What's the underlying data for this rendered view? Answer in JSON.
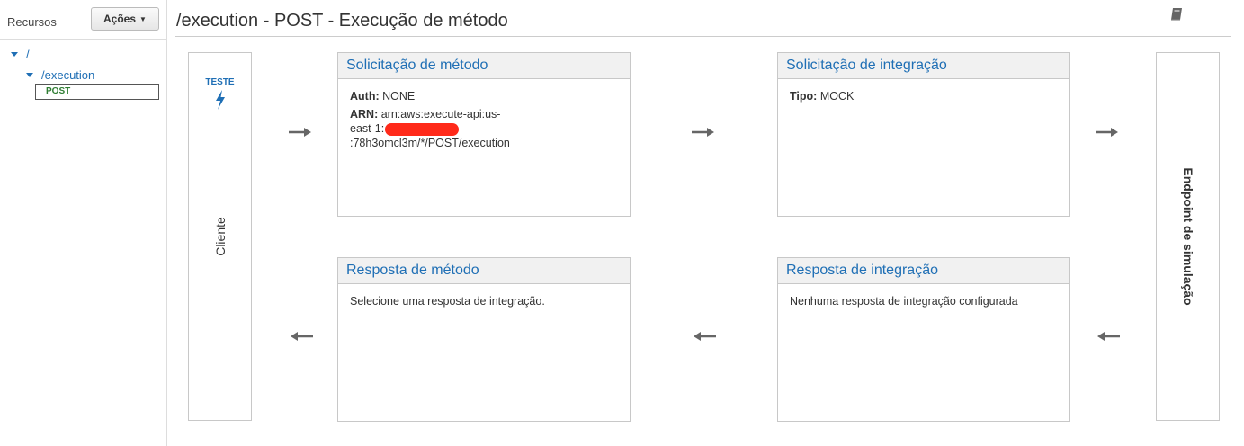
{
  "sidebar": {
    "title": "Recursos",
    "actions_label": "Ações",
    "tree": {
      "root": "/",
      "child": "/execution",
      "method": "POST"
    }
  },
  "header": {
    "title": "/execution - POST - Execução de método"
  },
  "client": {
    "test_label": "TESTE",
    "label": "Cliente"
  },
  "endpoint": {
    "label": "Endpoint de simulação"
  },
  "method_request": {
    "title": "Solicitação de método",
    "auth_key": "Auth:",
    "auth_value": "NONE",
    "arn_key": "ARN:",
    "arn_value_1": "arn:aws:execute-api:us-",
    "arn_value_2a": "east-1:",
    "arn_value_2b": ":78h3omcl3m/*/POST/execution"
  },
  "integration_request": {
    "title": "Solicitação de integração",
    "type_key": "Tipo:",
    "type_value": "MOCK"
  },
  "method_response": {
    "title": "Resposta de método",
    "body": "Selecione uma resposta de integração."
  },
  "integration_response": {
    "title": "Resposta de integração",
    "body": "Nenhuma resposta de integração configurada"
  },
  "colors": {
    "link_blue": "#1f6fb5",
    "method_green": "#2e7d32",
    "redaction_red": "#ff2a1a"
  },
  "icons": [
    "caret-down-icon",
    "tree-expand-icon",
    "book-icon",
    "lightning-icon",
    "arrow-right-icon",
    "arrow-left-icon"
  ]
}
